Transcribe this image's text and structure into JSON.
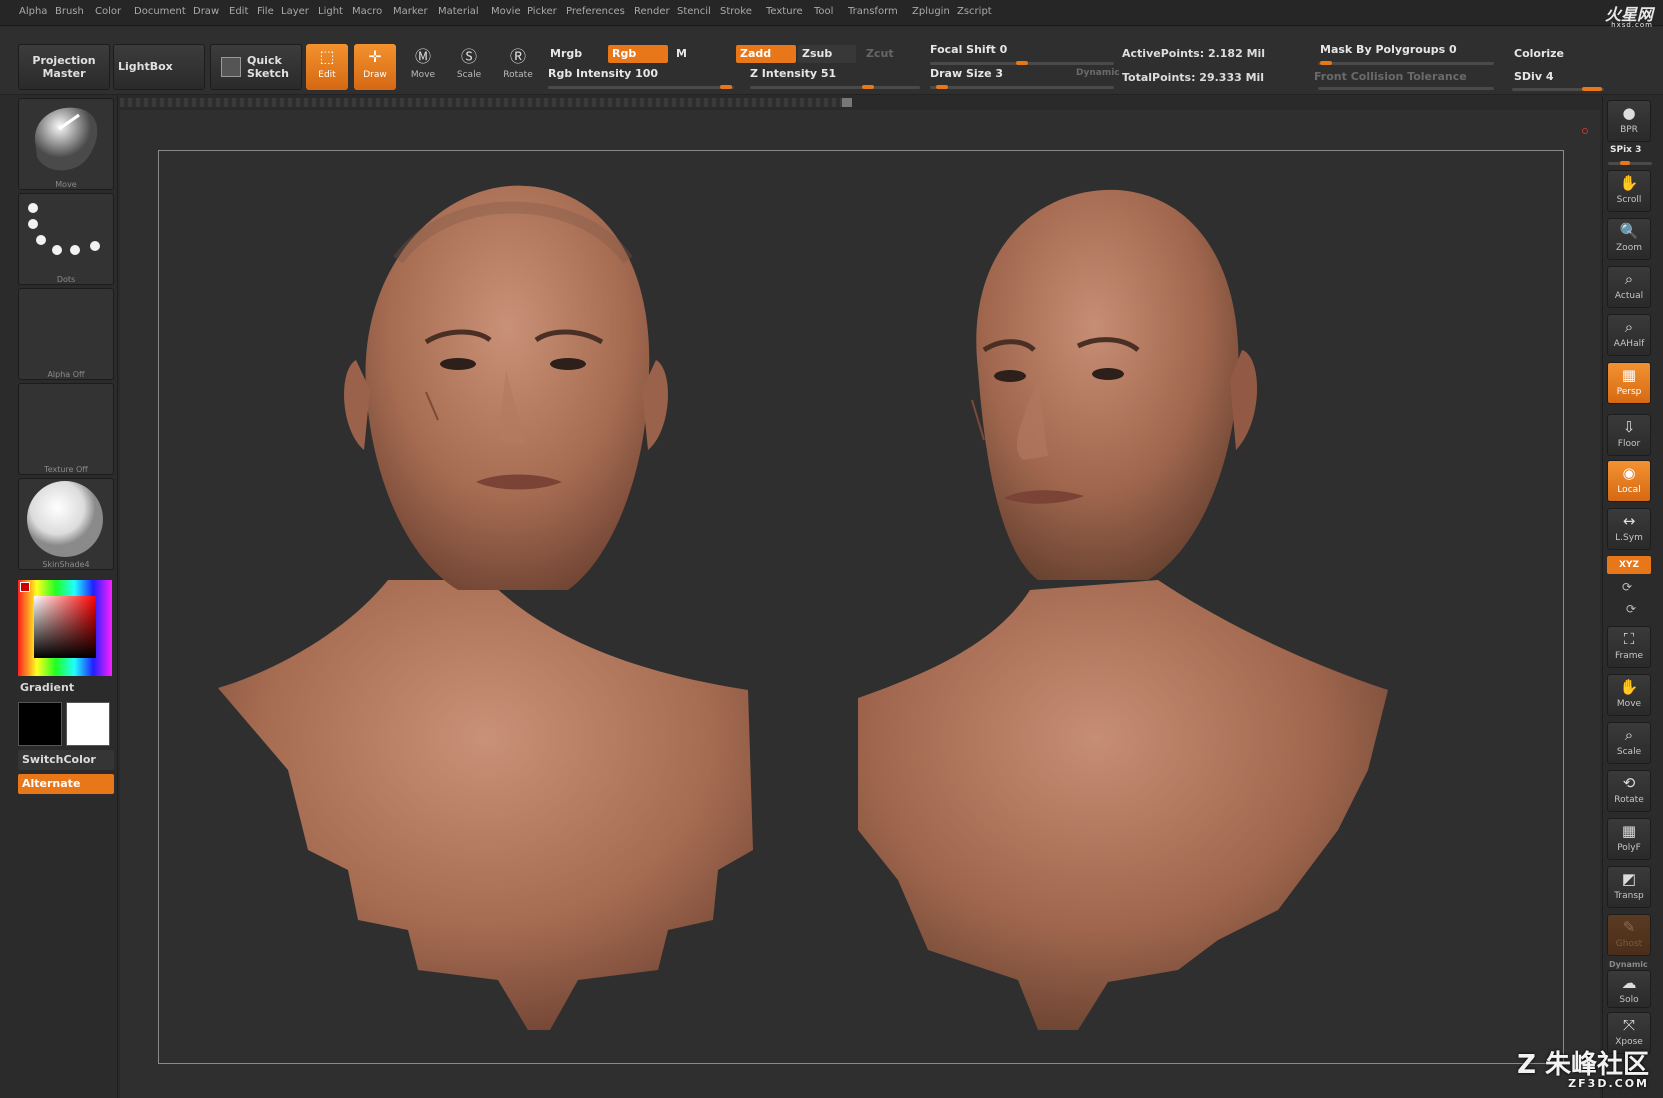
{
  "menu": [
    "Alpha",
    "Brush",
    "Color",
    "Document",
    "Draw",
    "Edit",
    "File",
    "Layer",
    "Light",
    "Macro",
    "Marker",
    "Material",
    "Movie",
    "Picker",
    "Preferences",
    "Render",
    "Stencil",
    "Stroke",
    "Texture",
    "Tool",
    "Transform",
    "Zplugin",
    "Zscript"
  ],
  "brand": {
    "logo": "火星网",
    "sub": "hxsd.com"
  },
  "toolbar": {
    "projection_master": "Projection Master",
    "lightbox": "LightBox",
    "quick_sketch": "Quick Sketch",
    "edit": "Edit",
    "draw": "Draw",
    "move": "Move",
    "scale": "Scale",
    "rotate": "Rotate",
    "mrgb": "Mrgb",
    "rgb": "Rgb",
    "m": "M",
    "zadd": "Zadd",
    "zsub": "Zsub",
    "zcut": "Zcut",
    "rgb_intensity": "Rgb Intensity 100",
    "z_intensity": "Z Intensity 51",
    "focal_shift": "Focal Shift 0",
    "draw_size": "Draw Size 3",
    "dynamic": "Dynamic",
    "active_points": "ActivePoints: 2.182 Mil",
    "total_points": "TotalPoints: 29.333 Mil",
    "mask_by_polygroups": "Mask By Polygroups 0",
    "front_collision_tolerance": "Front Collision Tolerance",
    "colorize": "Colorize",
    "sdiv": "SDiv 4"
  },
  "left_panel": {
    "brush_caption": "Move",
    "stroke_caption": "Dots",
    "alpha_caption": "Alpha Off",
    "texture_caption": "Texture Off",
    "material_caption": "SkinShade4",
    "gradient": "Gradient",
    "switch_color": "SwitchColor",
    "alternate": "Alternate"
  },
  "right_shelf": {
    "bpr": "BPR",
    "spix": "SPix 3",
    "scroll": "Scroll",
    "zoom": "Zoom",
    "actual": "Actual",
    "aahalf": "AAHalf",
    "persp": "Persp",
    "floor": "Floor",
    "local": "Local",
    "lsym": "L.Sym",
    "xyz": "XYZ",
    "frame": "Frame",
    "move": "Move",
    "scale": "Scale",
    "rotate": "Rotate",
    "polyf": "PolyF",
    "transp": "Transp",
    "ghost": "Ghost",
    "dynamic": "Dynamic",
    "solo": "Solo",
    "xpose": "Xpose"
  },
  "watermark": {
    "main": "Z 朱峰社区",
    "sub": "ZF3D.COM"
  },
  "levels": {
    "rgb_intensity": 100,
    "z_intensity": 51,
    "focal_shift": 0,
    "draw_size": 3,
    "spix": 3,
    "sdiv": 4
  },
  "colors": {
    "accent": "#e8771a",
    "skin": "#b87a5e",
    "background": "#2f2f2f"
  }
}
